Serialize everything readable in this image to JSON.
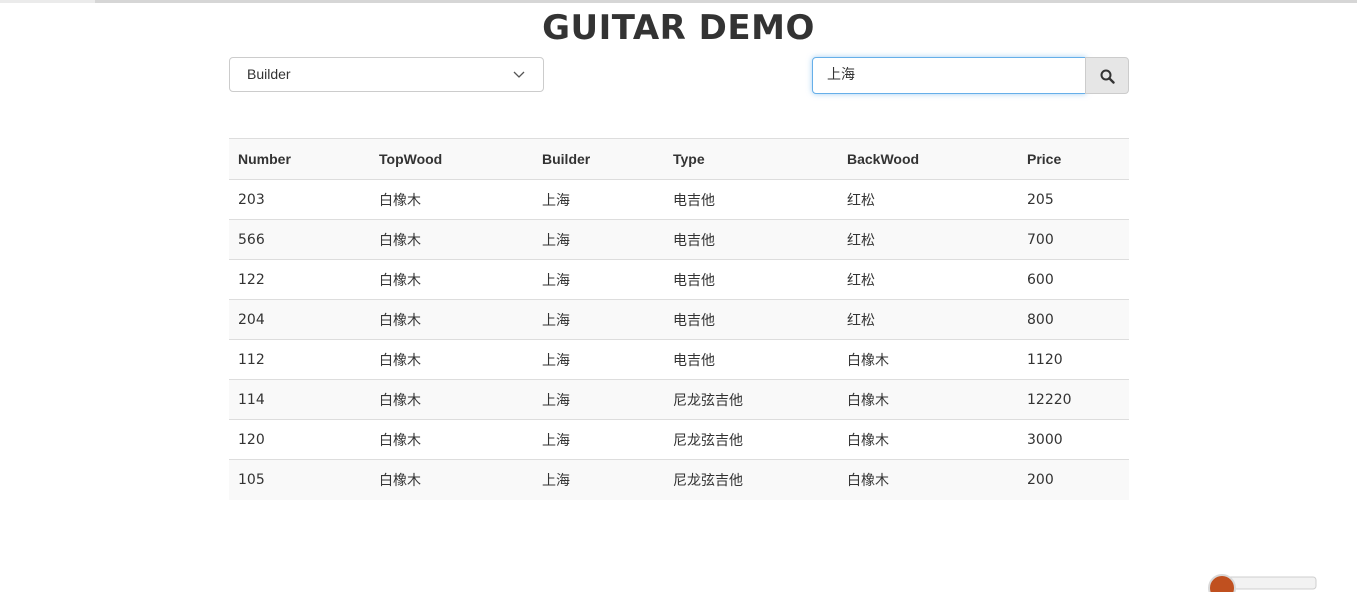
{
  "header": {
    "title": "GUITAR DEMO"
  },
  "filter": {
    "selected": "Builder",
    "options": [
      "Builder"
    ]
  },
  "search": {
    "value": "上海",
    "button_icon": "search-icon"
  },
  "table": {
    "columns": [
      "Number",
      "TopWood",
      "Builder",
      "Type",
      "BackWood",
      "Price"
    ],
    "rows": [
      [
        "203",
        "白橡木",
        "上海",
        "电吉他",
        "红松",
        "205"
      ],
      [
        "566",
        "白橡木",
        "上海",
        "电吉他",
        "红松",
        "700"
      ],
      [
        "122",
        "白橡木",
        "上海",
        "电吉他",
        "红松",
        "600"
      ],
      [
        "204",
        "白橡木",
        "上海",
        "电吉他",
        "红松",
        "800"
      ],
      [
        "112",
        "白橡木",
        "上海",
        "电吉他",
        "白橡木",
        "1120"
      ],
      [
        "114",
        "白橡木",
        "上海",
        "尼龙弦吉他",
        "白橡木",
        "12220"
      ],
      [
        "120",
        "白橡木",
        "上海",
        "尼龙弦吉他",
        "白橡木",
        "3000"
      ],
      [
        "105",
        "白橡木",
        "上海",
        "尼龙弦吉他",
        "白橡木",
        "200"
      ]
    ]
  },
  "colors": {
    "focus_border": "#66afe9",
    "stripe": "#f9f9f9",
    "border": "#dddddd"
  }
}
